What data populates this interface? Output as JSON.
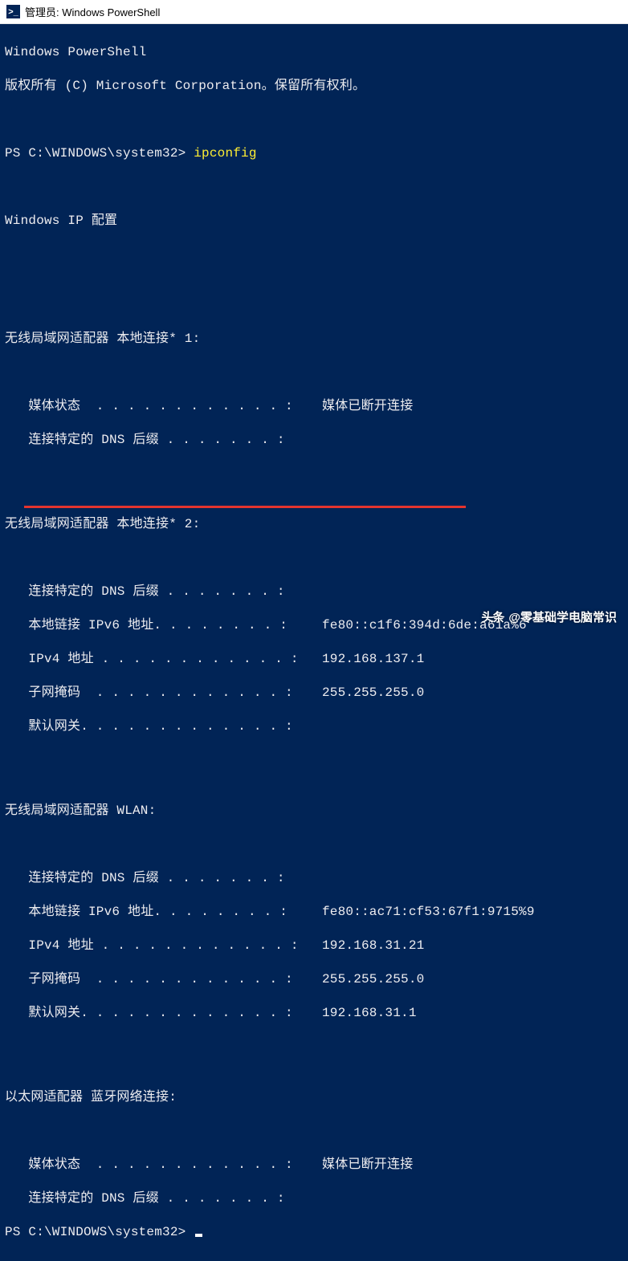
{
  "title_bar": {
    "icon_glyph": ">_",
    "text": "管理员: Windows PowerShell"
  },
  "header": {
    "line1": "Windows PowerShell",
    "line2": "版权所有 (C) Microsoft Corporation。保留所有权利。"
  },
  "prompt1": {
    "path": "PS C:\\WINDOWS\\system32> ",
    "command": "ipconfig"
  },
  "ip_title": "Windows IP 配置",
  "adapters": [
    {
      "header": "无线局域网适配器 本地连接* 1:",
      "rows": [
        {
          "label": "   媒体状态  . . . . . . . . . . . . : ",
          "value": "媒体已断开连接"
        },
        {
          "label": "   连接特定的 DNS 后缀 . . . . . . . :",
          "value": ""
        }
      ]
    },
    {
      "header": "无线局域网适配器 本地连接* 2:",
      "rows": [
        {
          "label": "   连接特定的 DNS 后缀 . . . . . . . :",
          "value": ""
        },
        {
          "label": "   本地链接 IPv6 地址. . . . . . . . : ",
          "value": "fe80::c1f6:394d:6de:a61a%6"
        },
        {
          "label": "   IPv4 地址 . . . . . . . . . . . . : ",
          "value": "192.168.137.1"
        },
        {
          "label": "   子网掩码  . . . . . . . . . . . . : ",
          "value": "255.255.255.0"
        },
        {
          "label": "   默认网关. . . . . . . . . . . . . :",
          "value": ""
        }
      ]
    },
    {
      "header": "无线局域网适配器 WLAN:",
      "rows": [
        {
          "label": "   连接特定的 DNS 后缀 . . . . . . . :",
          "value": ""
        },
        {
          "label": "   本地链接 IPv6 地址. . . . . . . . : ",
          "value": "fe80::ac71:cf53:67f1:9715%9"
        },
        {
          "label": "   IPv4 地址 . . . . . . . . . . . . : ",
          "value": "192.168.31.21"
        },
        {
          "label": "   子网掩码  . . . . . . . . . . . . : ",
          "value": "255.255.255.0"
        },
        {
          "label": "   默认网关. . . . . . . . . . . . . : ",
          "value": "192.168.31.1"
        }
      ]
    },
    {
      "header": "以太网适配器 蓝牙网络连接:",
      "rows": [
        {
          "label": "   媒体状态  . . . . . . . . . . . . : ",
          "value": "媒体已断开连接"
        },
        {
          "label": "   连接特定的 DNS 后缀 . . . . . . . :",
          "value": ""
        }
      ]
    }
  ],
  "prompt2": {
    "path": "PS C:\\WINDOWS\\system32> "
  },
  "watermark": {
    "left": "头条",
    "right": "@零基础学电脑常识"
  },
  "highlight": {
    "color": "#e4342e"
  }
}
